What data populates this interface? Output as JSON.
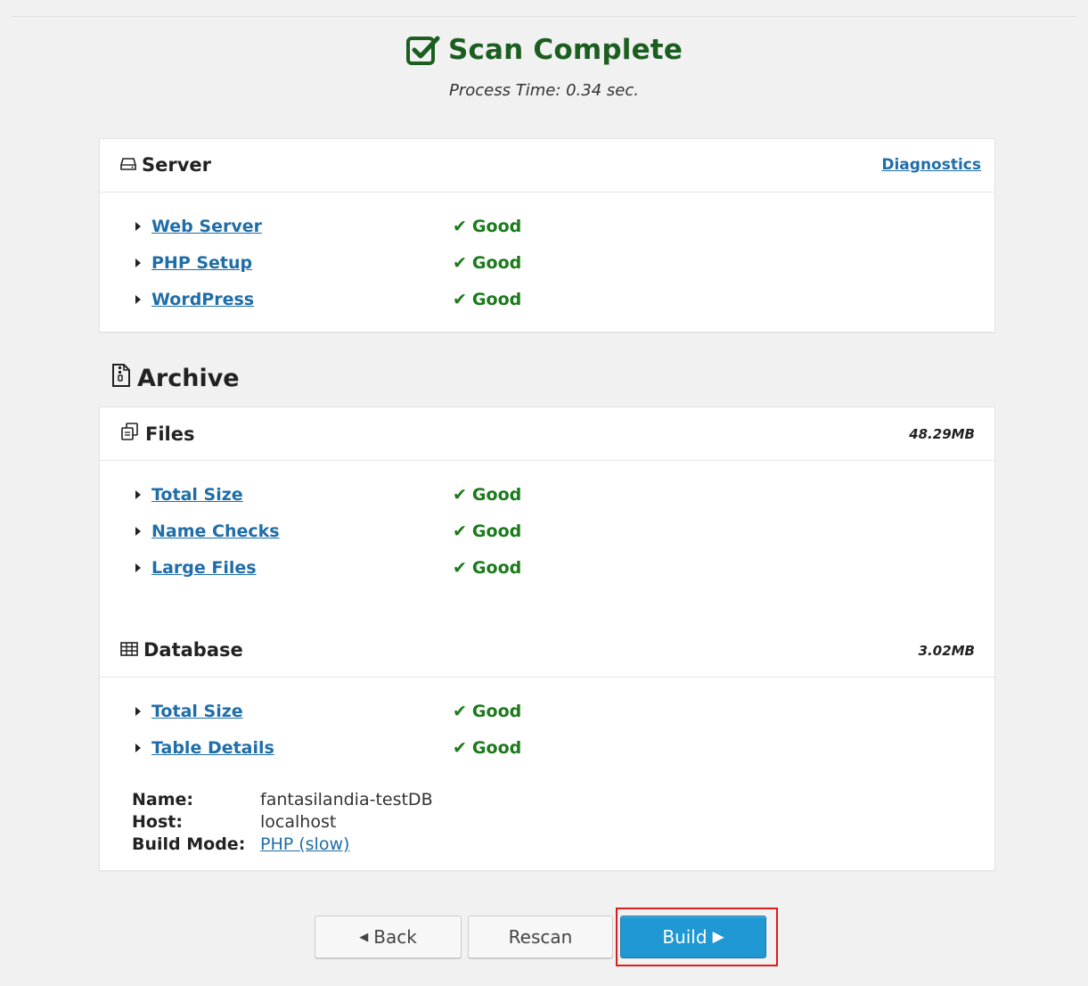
{
  "header": {
    "title": "Scan Complete",
    "subtitle": "Process Time: 0.34 sec."
  },
  "server": {
    "title": "Server",
    "diagnostics_link": "Diagnostics",
    "items": [
      {
        "label": "Web Server",
        "status": "Good"
      },
      {
        "label": "PHP Setup",
        "status": "Good"
      },
      {
        "label": "WordPress",
        "status": "Good"
      }
    ]
  },
  "archive": {
    "title": "Archive",
    "files": {
      "title": "Files",
      "size": "48.29MB",
      "items": [
        {
          "label": "Total Size",
          "status": "Good"
        },
        {
          "label": "Name Checks",
          "status": "Good"
        },
        {
          "label": "Large Files",
          "status": "Good"
        }
      ]
    },
    "database": {
      "title": "Database",
      "size": "3.02MB",
      "items": [
        {
          "label": "Total Size",
          "status": "Good"
        },
        {
          "label": "Table Details",
          "status": "Good"
        }
      ],
      "info": {
        "name_label": "Name:",
        "name_value": "fantasilandia-testDB",
        "host_label": "Host:",
        "host_value": "localhost",
        "mode_label": "Build Mode:",
        "mode_value": "PHP (slow)"
      }
    }
  },
  "buttons": {
    "back": "Back",
    "rescan": "Rescan",
    "build": "Build"
  },
  "colors": {
    "good": "#1b7a1b",
    "link": "#1f6ea8",
    "primary": "#1f98d3",
    "title": "#1b5e20",
    "highlight": "#e01b1b"
  }
}
